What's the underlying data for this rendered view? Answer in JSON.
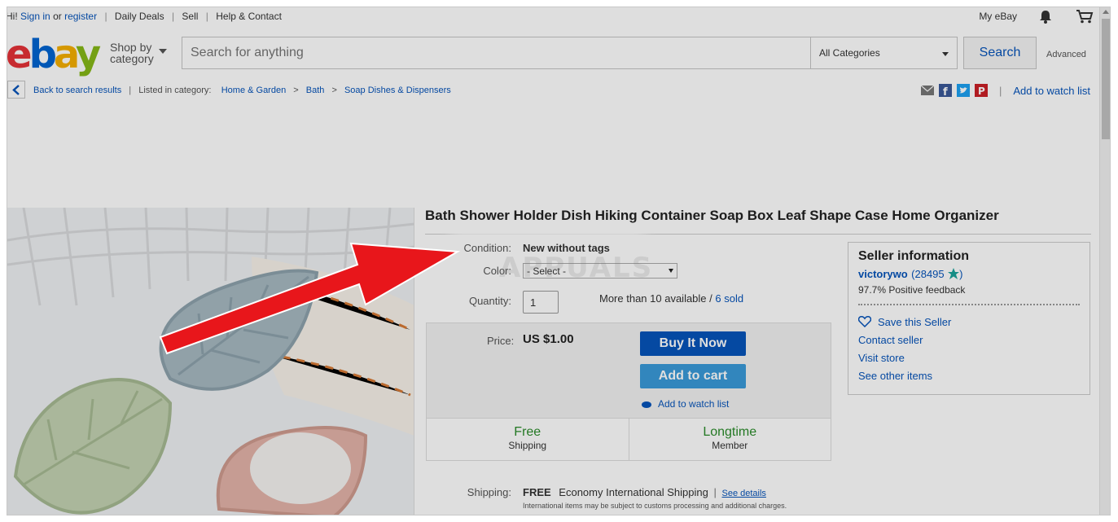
{
  "topbar": {
    "greeting": "Hi!",
    "sign_in": "Sign in",
    "or": "or",
    "register": "register",
    "daily_deals": "Daily Deals",
    "sell": "Sell",
    "help": "Help & Contact",
    "my_ebay": "My eBay"
  },
  "header": {
    "logo": [
      "e",
      "b",
      "a",
      "y"
    ],
    "shop_by_line1": "Shop by",
    "shop_by_line2": "category",
    "search_placeholder": "Search for anything",
    "category": "All Categories",
    "search_button": "Search",
    "advanced": "Advanced"
  },
  "breadcrumb": {
    "back": "Back to search results",
    "listed_in": "Listed in category:",
    "items": [
      "Home & Garden",
      "Bath",
      "Soap Dishes & Dispensers"
    ],
    "add_to_watch": "Add to watch list"
  },
  "item": {
    "title": "Bath Shower Holder Dish Hiking Container Soap Box Leaf Shape Case Home Organizer",
    "condition_label": "Condition:",
    "condition_value": "New without tags",
    "color_label": "Color:",
    "color_value": "- Select -",
    "quantity_label": "Quantity:",
    "quantity_value": "1",
    "availability": "More than 10 available /",
    "sold": "6 sold",
    "price_label": "Price:",
    "price": "US $1.00",
    "buy_now": "Buy It Now",
    "add_to_cart": "Add to cart",
    "add_to_watch": "Add to watch list",
    "badge1_big": "Free",
    "badge1_small": "Shipping",
    "badge2_big": "Longtime",
    "badge2_small": "Member",
    "shipping_label": "Shipping:",
    "shipping_free": "FREE",
    "shipping_method": "Economy International Shipping",
    "see_details": "See details",
    "shipping_note": "International items may be subject to customs processing and additional charges."
  },
  "seller": {
    "heading": "Seller information",
    "name": "victorywo",
    "score": "28495",
    "feedback": "97.7% Positive feedback",
    "save": "Save this Seller",
    "contact": "Contact seller",
    "visit": "Visit store",
    "other": "See other items"
  },
  "watermark": "APPUALS",
  "colors": {
    "link": "#0654ba",
    "buy_button": "#0654ba",
    "cart_button": "#3a9ad9",
    "badge_green": "#2a8b2a",
    "annotation_arrow": "#e8161b"
  }
}
